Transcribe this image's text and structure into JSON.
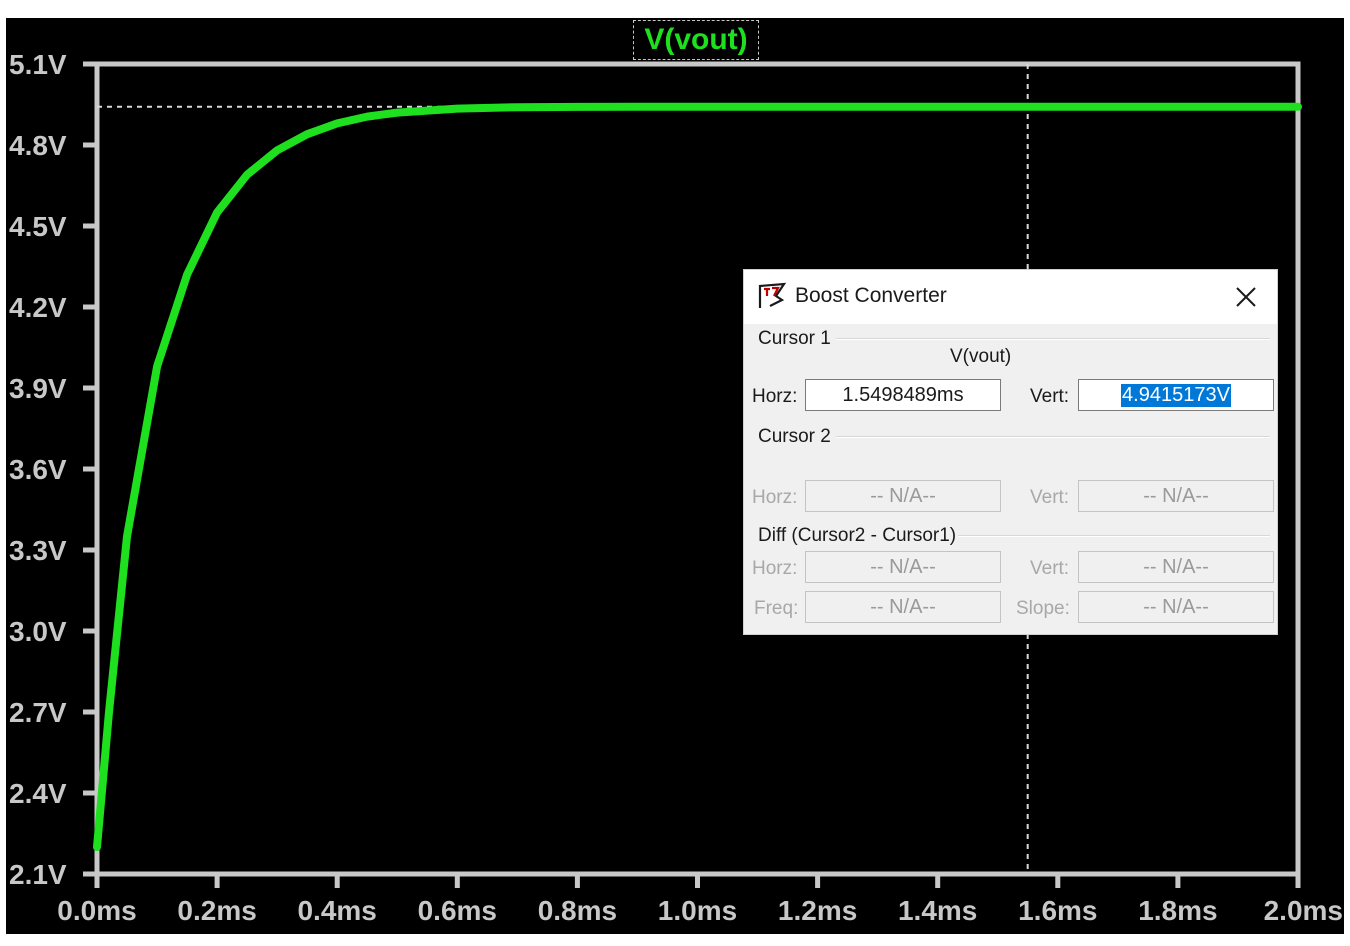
{
  "chart_data": {
    "type": "line",
    "title": "V(vout)",
    "xlabel": "",
    "ylabel": "",
    "x_ticks": [
      "0.0ms",
      "0.2ms",
      "0.4ms",
      "0.6ms",
      "0.8ms",
      "1.0ms",
      "1.2ms",
      "1.4ms",
      "1.6ms",
      "1.8ms",
      "2.0ms"
    ],
    "y_ticks": [
      "2.1V",
      "2.4V",
      "2.7V",
      "3.0V",
      "3.3V",
      "3.6V",
      "3.9V",
      "4.2V",
      "4.5V",
      "4.8V",
      "5.1V"
    ],
    "xlim": [
      0.0,
      2.0
    ],
    "ylim": [
      2.1,
      5.1
    ],
    "x_unit": "ms",
    "y_unit": "V",
    "grid": false,
    "series": [
      {
        "name": "V(vout)",
        "color": "#1fe01f",
        "x": [
          0.0,
          0.02,
          0.05,
          0.1,
          0.15,
          0.2,
          0.25,
          0.3,
          0.35,
          0.4,
          0.45,
          0.5,
          0.6,
          0.7,
          0.8,
          0.9,
          1.0,
          1.2,
          1.4,
          1.6,
          1.8,
          2.0
        ],
        "y": [
          2.2,
          2.7,
          3.35,
          3.98,
          4.32,
          4.55,
          4.69,
          4.78,
          4.84,
          4.88,
          4.905,
          4.92,
          4.935,
          4.94,
          4.941,
          4.9415,
          4.9415,
          4.9415,
          4.9415,
          4.9415,
          4.9415,
          4.9415
        ]
      }
    ],
    "cursor1": {
      "x": 1.5498489,
      "y": 4.9415173
    }
  },
  "dialog": {
    "title": "Boost Converter",
    "icon": "ltspice-icon",
    "close_icon": "close-icon",
    "cursor1": {
      "label": "Cursor 1",
      "trace": "V(vout)",
      "horz_label": "Horz:",
      "horz_value": "1.5498489ms",
      "vert_label": "Vert:",
      "vert_value": "4.9415173V"
    },
    "cursor2": {
      "label": "Cursor 2",
      "horz_label": "Horz:",
      "horz_value": "-- N/A--",
      "vert_label": "Vert:",
      "vert_value": "-- N/A--"
    },
    "diff": {
      "label": "Diff (Cursor2 - Cursor1)",
      "horz_label": "Horz:",
      "horz_value": "-- N/A--",
      "vert_label": "Vert:",
      "vert_value": "-- N/A--",
      "freq_label": "Freq:",
      "freq_value": "-- N/A--",
      "slope_label": "Slope:",
      "slope_value": "-- N/A--"
    }
  },
  "colors": {
    "background": "#000000",
    "axis": "#c8c8c8",
    "trace": "#1fe01f",
    "selection": "#0078d7"
  }
}
